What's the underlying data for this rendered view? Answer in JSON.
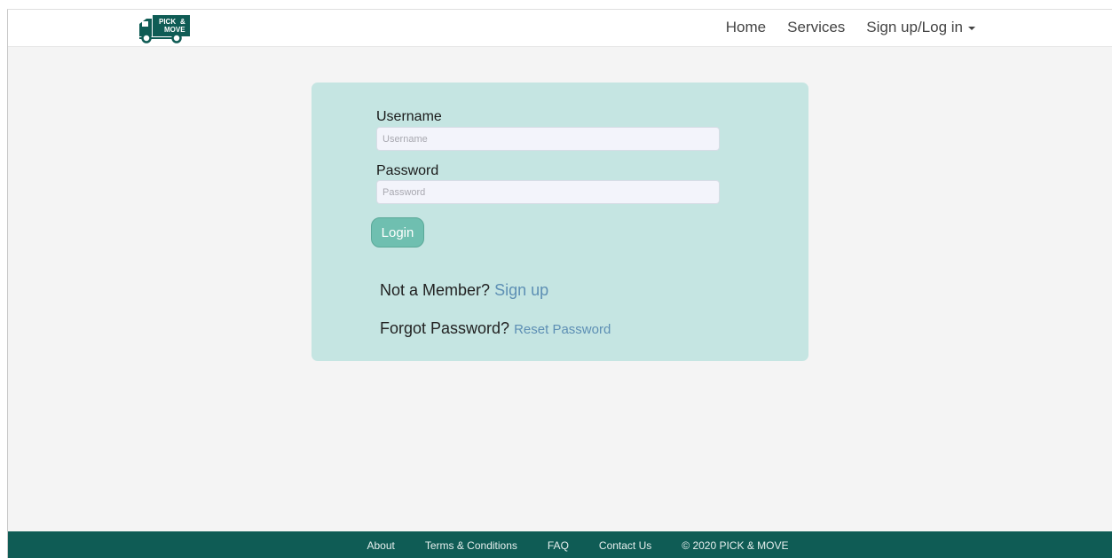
{
  "brand": {
    "logo_text_top": "PICK",
    "logo_text_amp": "&",
    "logo_text_bottom": "MOVE",
    "color": "#0f5c55"
  },
  "nav": {
    "home": "Home",
    "services": "Services",
    "auth": "Sign up/Log in"
  },
  "form": {
    "username_label": "Username",
    "username_placeholder": "Username",
    "password_label": "Password",
    "password_placeholder": "Password",
    "login_label": "Login",
    "member_prompt": "Not a Member?",
    "signup_link": "Sign up",
    "forgot_prompt": "Forgot Password?",
    "reset_link": "Reset Password"
  },
  "footer": {
    "about": "About",
    "terms": "Terms & Conditions",
    "faq": "FAQ",
    "contact": "Contact Us",
    "copyright": "© 2020 PICK & MOVE"
  },
  "colors": {
    "card_bg": "#c5e5e2",
    "button_bg": "#6fbfb0",
    "link": "#5d8fb4",
    "footer_bg": "#0f5c55"
  }
}
